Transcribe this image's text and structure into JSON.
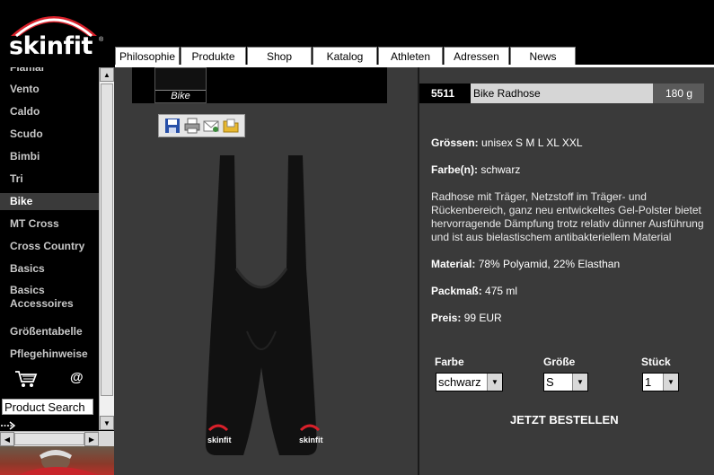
{
  "brand": {
    "logo_text": "skinfit",
    "logo_mark": "®"
  },
  "nav": {
    "tabs": [
      "Philosophie",
      "Produkte",
      "Shop",
      "Katalog",
      "Athleten",
      "Adressen",
      "News"
    ]
  },
  "sidebar": {
    "items": [
      "Flamar",
      "Vento",
      "Caldo",
      "Scudo",
      "Bimbi",
      "Tri",
      "Bike",
      "MT Cross",
      "Cross Country",
      "Basics",
      "Basics Accessoires",
      "Größentabelle",
      "Pflegehinweise"
    ],
    "active_item": "Bike",
    "at_symbol": "@",
    "search_value": "Product Search"
  },
  "gallery": {
    "thumb_label": "Bike"
  },
  "product": {
    "number": "5511",
    "name": "Bike Radhose",
    "weight": "180 g",
    "sizes_label": "Grössen:",
    "sizes": "unisex S M L XL XXL",
    "color_label": "Farbe(n):",
    "color": "schwarz",
    "description": "Radhose mit Träger, Netzstoff im Träger- und Rückenbereich, ganz neu entwickeltes Gel-Polster bietet hervorragende Dämpfung trotz relativ dünner Ausführung und ist aus bielastischem antibakteriellem Material",
    "material_label": "Material:",
    "material": "78% Polyamid, 22% Elasthan",
    "pack_label": "Packmaß:",
    "pack": "475 ml",
    "price_label": "Preis:",
    "price": "99 EUR",
    "image_brand": "skinfit"
  },
  "order": {
    "color_label": "Farbe",
    "color_value": "schwarz",
    "size_label": "Größe",
    "size_value": "S",
    "qty_label": "Stück",
    "qty_value": "1",
    "button_label": "JETZT BESTELLEN"
  },
  "colors": {
    "brand_red": "#d8202a",
    "panel_gray": "#3a3a3a",
    "background": "#000000"
  }
}
